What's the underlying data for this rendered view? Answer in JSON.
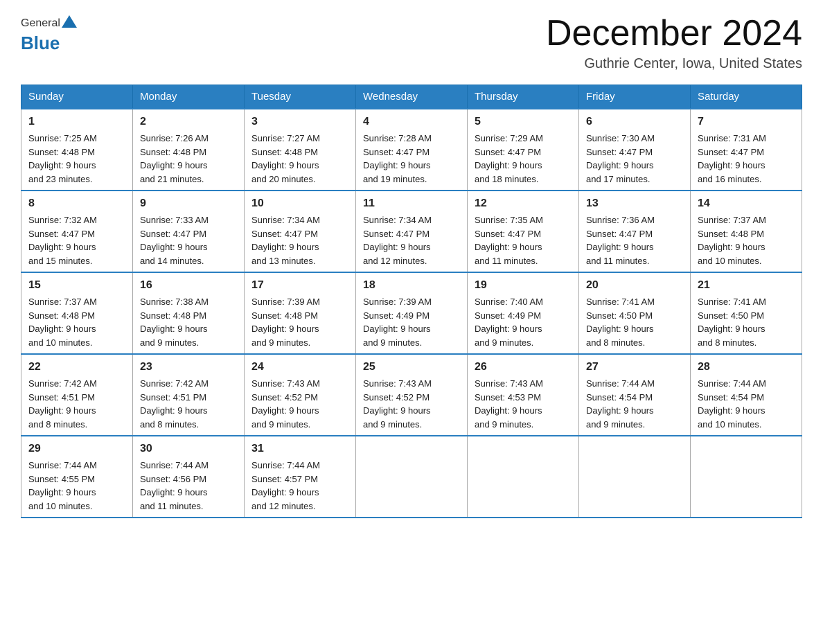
{
  "header": {
    "logo_general": "General",
    "logo_blue": "Blue",
    "month_title": "December 2024",
    "location": "Guthrie Center, Iowa, United States"
  },
  "days_of_week": [
    "Sunday",
    "Monday",
    "Tuesday",
    "Wednesday",
    "Thursday",
    "Friday",
    "Saturday"
  ],
  "weeks": [
    [
      {
        "date": "1",
        "sunrise": "7:25 AM",
        "sunset": "4:48 PM",
        "daylight": "9 hours and 23 minutes."
      },
      {
        "date": "2",
        "sunrise": "7:26 AM",
        "sunset": "4:48 PM",
        "daylight": "9 hours and 21 minutes."
      },
      {
        "date": "3",
        "sunrise": "7:27 AM",
        "sunset": "4:48 PM",
        "daylight": "9 hours and 20 minutes."
      },
      {
        "date": "4",
        "sunrise": "7:28 AM",
        "sunset": "4:47 PM",
        "daylight": "9 hours and 19 minutes."
      },
      {
        "date": "5",
        "sunrise": "7:29 AM",
        "sunset": "4:47 PM",
        "daylight": "9 hours and 18 minutes."
      },
      {
        "date": "6",
        "sunrise": "7:30 AM",
        "sunset": "4:47 PM",
        "daylight": "9 hours and 17 minutes."
      },
      {
        "date": "7",
        "sunrise": "7:31 AM",
        "sunset": "4:47 PM",
        "daylight": "9 hours and 16 minutes."
      }
    ],
    [
      {
        "date": "8",
        "sunrise": "7:32 AM",
        "sunset": "4:47 PM",
        "daylight": "9 hours and 15 minutes."
      },
      {
        "date": "9",
        "sunrise": "7:33 AM",
        "sunset": "4:47 PM",
        "daylight": "9 hours and 14 minutes."
      },
      {
        "date": "10",
        "sunrise": "7:34 AM",
        "sunset": "4:47 PM",
        "daylight": "9 hours and 13 minutes."
      },
      {
        "date": "11",
        "sunrise": "7:34 AM",
        "sunset": "4:47 PM",
        "daylight": "9 hours and 12 minutes."
      },
      {
        "date": "12",
        "sunrise": "7:35 AM",
        "sunset": "4:47 PM",
        "daylight": "9 hours and 11 minutes."
      },
      {
        "date": "13",
        "sunrise": "7:36 AM",
        "sunset": "4:47 PM",
        "daylight": "9 hours and 11 minutes."
      },
      {
        "date": "14",
        "sunrise": "7:37 AM",
        "sunset": "4:48 PM",
        "daylight": "9 hours and 10 minutes."
      }
    ],
    [
      {
        "date": "15",
        "sunrise": "7:37 AM",
        "sunset": "4:48 PM",
        "daylight": "9 hours and 10 minutes."
      },
      {
        "date": "16",
        "sunrise": "7:38 AM",
        "sunset": "4:48 PM",
        "daylight": "9 hours and 9 minutes."
      },
      {
        "date": "17",
        "sunrise": "7:39 AM",
        "sunset": "4:48 PM",
        "daylight": "9 hours and 9 minutes."
      },
      {
        "date": "18",
        "sunrise": "7:39 AM",
        "sunset": "4:49 PM",
        "daylight": "9 hours and 9 minutes."
      },
      {
        "date": "19",
        "sunrise": "7:40 AM",
        "sunset": "4:49 PM",
        "daylight": "9 hours and 9 minutes."
      },
      {
        "date": "20",
        "sunrise": "7:41 AM",
        "sunset": "4:50 PM",
        "daylight": "9 hours and 8 minutes."
      },
      {
        "date": "21",
        "sunrise": "7:41 AM",
        "sunset": "4:50 PM",
        "daylight": "9 hours and 8 minutes."
      }
    ],
    [
      {
        "date": "22",
        "sunrise": "7:42 AM",
        "sunset": "4:51 PM",
        "daylight": "9 hours and 8 minutes."
      },
      {
        "date": "23",
        "sunrise": "7:42 AM",
        "sunset": "4:51 PM",
        "daylight": "9 hours and 8 minutes."
      },
      {
        "date": "24",
        "sunrise": "7:43 AM",
        "sunset": "4:52 PM",
        "daylight": "9 hours and 9 minutes."
      },
      {
        "date": "25",
        "sunrise": "7:43 AM",
        "sunset": "4:52 PM",
        "daylight": "9 hours and 9 minutes."
      },
      {
        "date": "26",
        "sunrise": "7:43 AM",
        "sunset": "4:53 PM",
        "daylight": "9 hours and 9 minutes."
      },
      {
        "date": "27",
        "sunrise": "7:44 AM",
        "sunset": "4:54 PM",
        "daylight": "9 hours and 9 minutes."
      },
      {
        "date": "28",
        "sunrise": "7:44 AM",
        "sunset": "4:54 PM",
        "daylight": "9 hours and 10 minutes."
      }
    ],
    [
      {
        "date": "29",
        "sunrise": "7:44 AM",
        "sunset": "4:55 PM",
        "daylight": "9 hours and 10 minutes."
      },
      {
        "date": "30",
        "sunrise": "7:44 AM",
        "sunset": "4:56 PM",
        "daylight": "9 hours and 11 minutes."
      },
      {
        "date": "31",
        "sunrise": "7:44 AM",
        "sunset": "4:57 PM",
        "daylight": "9 hours and 12 minutes."
      },
      null,
      null,
      null,
      null
    ]
  ],
  "labels": {
    "sunrise": "Sunrise: ",
    "sunset": "Sunset: ",
    "daylight": "Daylight: "
  }
}
